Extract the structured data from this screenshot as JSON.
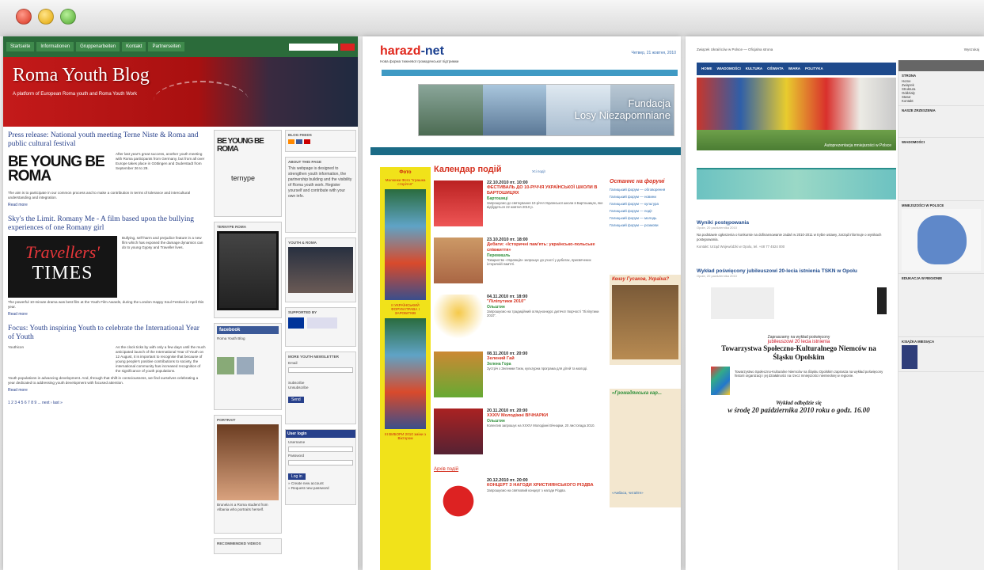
{
  "window": {
    "buttons": [
      "close",
      "minimize",
      "zoom"
    ]
  },
  "page1": {
    "nav": [
      "Startseite",
      "Informationen",
      "Gruppenarbeiten",
      "Kontakt",
      "Partnerseiten"
    ],
    "title": "Roma Youth Blog",
    "subtitle": "A platform of European Roma youth and Roma Youth Work",
    "posts": [
      {
        "title": "Press release: National youth meeting Terne Niste & Roma and public cultural festival",
        "logo": "BE YOUNG BE ROMA",
        "more": "Read more"
      },
      {
        "title": "Sky's the Limit. Romany Me - A film based upon the bullying experiences of one Romany girl",
        "logo1": "Travellers'",
        "logo2": "TIMES",
        "more": "Read more"
      },
      {
        "title": "Focus: Youth inspiring Youth to celebrate the International Year of Youth",
        "label": "Youthicon",
        "more": "Read more"
      }
    ],
    "pager": "1 2 3 4 5 6 7 8 9 ...  next ›  last »",
    "mid": {
      "logo": "BE YOUNG BE ROMA",
      "terny": "ternype",
      "box_a": "TERNYPE ROMA",
      "fb": "facebook",
      "fb_text": "Roma Youth Blog",
      "portrait": "PORTRAIT",
      "latest": "RECOMMENDED VIDEOS"
    },
    "right": {
      "heads": [
        "BLOG FEEDS",
        "ABOUT THIS PAGE",
        "YOUTH & ROMA",
        "SUPPORTED BY",
        "MORE YOUTH NEWSLETTER"
      ],
      "about": "This webpage is designed to strengthen youth information, the partnership building and the visibility of Roma youth work. Register yourself and contribute with your own info.",
      "email_label": "Email",
      "subscribe": "Subscribe",
      "unsubscribe": "Unsubscribe",
      "send": "Send",
      "user_login": "User login",
      "username": "Username",
      "password": "Password",
      "login": "Log in",
      "create": "» Create new account",
      "request": "» Request new password"
    }
  },
  "page2": {
    "logo_h": "harazd",
    "logo_n": "-net",
    "logo_sub": "Нова форма тижневої громадянської підтримки",
    "date": "Четвер, 21 жовтня, 2010",
    "fund": "Fundacja",
    "fund2": "Losy Niezapomniane",
    "yellow_head": "Фото",
    "yellow_cap": "Малюнки Фото \"Іграшка сторіччя\"",
    "yellow_cap2": "ІІ УКРАЇНСЬКИЙ ФОРУМ ПРАВА І ЗАРОБІТКІВ",
    "yellow_cap3": "ІІІ ВИБОРИ 2010 зміни з Віктором",
    "calendar": "Календар подій",
    "all_events": "Усі події",
    "events": [
      {
        "date": "22.10.2010 пт. 10:00",
        "title": "ФЕСТИВАЛЬ ДО 10-РІЧЧЯ УКРАЇНСЬКОЇ ШКОЛИ В БАРТОШИЦЯХ",
        "place": "Бартошиці",
        "desc": "Запрошуємо до святкування 10-річчя Української школи в Бартошицях, яке відбудеться 22 жовтня 2010 р."
      },
      {
        "date": "23.10.2010 пт. 18:00",
        "title": "Дебати: «Історичні пам'ять: українсько-польське співжиття»",
        "place": "Перемишль",
        "desc": "Товариство «Українців» запрошує до участі у дебатах, присвячених історичній пам'яті."
      },
      {
        "date": "04.11.2010 пт. 18:00",
        "title": "\"Ліліпутики 2010\"",
        "place": "Ольштин",
        "desc": "Запрошуємо на традиційний огляд-конкурс дитячої творчості \"Ліліпутики 2010\"."
      },
      {
        "date": "08.11.2010 пт. 20:00",
        "title": "Зелений Гай",
        "place": "Зелена Гора",
        "desc": "Зустріч з Зеленим Гаєм, культурна програма для дітей та молоді."
      },
      {
        "date": "20.11.2010 пт. 20:00",
        "title": "XXXIV Молодіжні ВІЧНАРКИ",
        "place": "Ольштин",
        "desc": "Колектив запрошує на XXXIV Молодіжні Вічнарки, 20 листопада 2010."
      },
      {
        "date": "20.12.2010 пт. 20:00",
        "title": "КОНЦЕРТ З НАГОДИ ХРИСТИЯНСЬКОГО РІЗДВА",
        "place": "",
        "desc": "Запрошуємо на святковий концерт з нагоди Різдва."
      }
    ],
    "archive": "Архів подій",
    "side_head": "Останнє на форумі",
    "side_links": [
      "Галицький форум — обговорення",
      "Галицький форум — новини",
      "Галицький форум — культура",
      "Галицький форум — події",
      "Галицький форум — молодь",
      "Галицький форум — розмови"
    ],
    "dog_head": "Кенгу Гусаков, Україна?",
    "ad_head": "«Громадянська кар...",
    "ad2": "«Амбаса, читайте»"
  },
  "page3": {
    "top_left": "Związek Ukraińców w Polsce — Oficjalna strona",
    "top_right": "Wyszukaj",
    "nav": [
      "HOME",
      "WIADOMOŚCI",
      "KULTURA",
      "OŚWIATA",
      "WIARA",
      "POLITYKA"
    ],
    "hero_caption": "Autoprezentacja mniejszości w Polsce",
    "article1": "Wyniki postępowania",
    "meta1": "Opole, 20 października 2010",
    "text1": "Na podstawie ogłoszenia o konkursie na dofinansowanie zadań w 2010-2011 w trybie ustawy, zarząd informuje o wynikach postępowania.",
    "article2": "Wykład poświęcony jubileuszowi 20-lecia istnienia TSKN w Opolu",
    "meta2": "Opole, 20 października 2010",
    "doc_intro": "Zapraszamy na wykład poświęcony",
    "doc_red": "jubileuszowi 20 lecia istnienia",
    "doc_title": "Towarzystwa Społeczno-Kulturalnego Niemców na Śląsku Opolskim",
    "doc_when": "Wykład odbędzie się",
    "doc_date": "w środę 20 października 2010 roku o godz. 16.00",
    "right": {
      "sections": [
        "STRONA",
        "NASZE ZRZESZENIA",
        "WIADOMOŚCI",
        "MNIEJSZOŚCI W POLSCE",
        "EDUKACJA W REGIONIE",
        "KSIĄŻKA MIESIĄCA"
      ],
      "links": [
        "Home",
        "Związek",
        "Struktura",
        "Oddziały",
        "Statut",
        "Kontakt"
      ]
    }
  }
}
